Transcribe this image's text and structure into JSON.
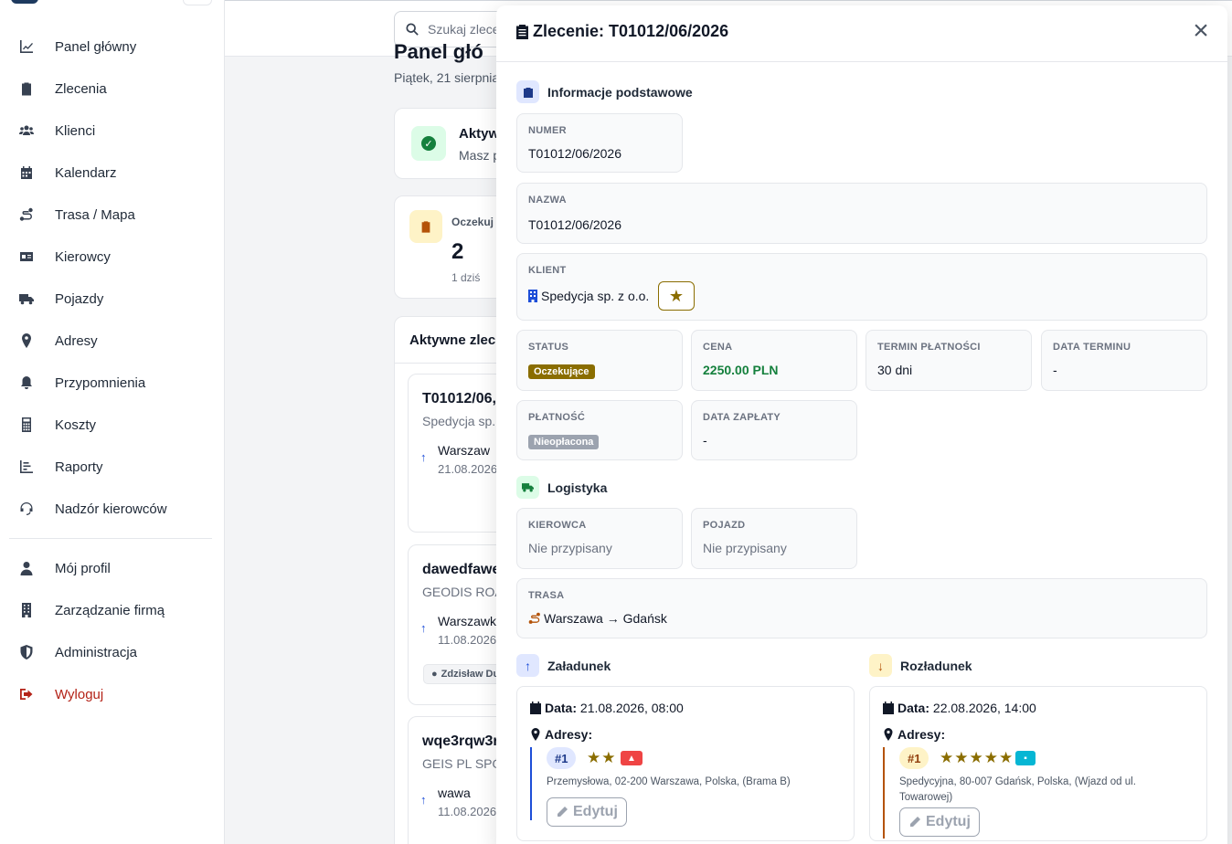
{
  "sidebar": {
    "items": [
      {
        "label": "Panel główny",
        "icon": "chart-line-icon"
      },
      {
        "label": "Zlecenia",
        "icon": "clipboard-icon"
      },
      {
        "label": "Klienci",
        "icon": "users-icon"
      },
      {
        "label": "Kalendarz",
        "icon": "calendar-icon"
      },
      {
        "label": "Trasa / Mapa",
        "icon": "route-icon"
      },
      {
        "label": "Kierowcy",
        "icon": "id-card-icon"
      },
      {
        "label": "Pojazdy",
        "icon": "truck-icon"
      },
      {
        "label": "Adresy",
        "icon": "map-pin-icon"
      },
      {
        "label": "Przypomnienia",
        "icon": "bell-icon"
      },
      {
        "label": "Koszty",
        "icon": "calculator-icon"
      },
      {
        "label": "Raporty",
        "icon": "chart-bar-icon"
      },
      {
        "label": "Nadzór kierowców",
        "icon": "headset-icon"
      }
    ],
    "bottom_items": [
      {
        "label": "Mój profil",
        "icon": "user-icon"
      },
      {
        "label": "Zarządzanie firmą",
        "icon": "building-icon"
      },
      {
        "label": "Administracja",
        "icon": "shield-icon"
      },
      {
        "label": "Wyloguj",
        "icon": "logout-icon"
      }
    ]
  },
  "topbar": {
    "search_placeholder": "Szukaj zlece"
  },
  "page": {
    "title": "Panel głó",
    "date": "Piątek, 21 sierpnia"
  },
  "status_card": {
    "title": "Aktyw",
    "text": "Masz p"
  },
  "pending_card": {
    "label": "Oczekuj",
    "count": "2",
    "today": "1 dziś"
  },
  "active_orders": {
    "title": "Aktywne zlec",
    "orders": [
      {
        "title": "T01012/06,",
        "client": "Spedycja sp. z",
        "city": "Warszaw",
        "date": "21.08.2026",
        "driver": ""
      },
      {
        "title": "dawedfawe",
        "client": "GEODIS ROAD",
        "city": "Warszawk",
        "date": "11.08.2026",
        "driver": "Zdzisław Du"
      },
      {
        "title": "wqe3rqw3r",
        "client": "GEIS PL SPÓŁ",
        "city": "wawa",
        "date": "11.08.2026",
        "driver": ""
      }
    ]
  },
  "modal": {
    "title": "Zlecenie: T01012/06/2026",
    "close": "×",
    "basic_section": "Informacje podstawowe",
    "numer_label": "NUMER",
    "numer": "T01012/06/2026",
    "nazwa_label": "NAZWA",
    "nazwa": "T01012/06/2026",
    "klient_label": "KLIENT",
    "klient": "Spedycja sp. z o.o.",
    "status_label": "STATUS",
    "status": "Oczekujące",
    "cena_label": "CENA",
    "cena": "2250.00 PLN",
    "termin_label": "TERMIN PŁATNOŚCI",
    "termin": "30 dni",
    "data_terminu_label": "DATA TERMINU",
    "data_terminu": "-",
    "platnosc_label": "PŁATNOŚĆ",
    "platnosc": "Nieopłacona",
    "data_zaplaty_label": "DATA ZAPŁATY",
    "data_zaplaty": "-",
    "logistics_section": "Logistyka",
    "kierowca_label": "KIEROWCA",
    "kierowca": "Nie przypisany",
    "pojazd_label": "POJAZD",
    "pojazd": "Nie przypisany",
    "trasa_label": "TRASA",
    "trasa": "Warszawa → Gdańsk",
    "loading": {
      "section": "Załadunek",
      "date_label": "Data:",
      "date": "21.08.2026, 08:00",
      "addr_label": "Adresy:",
      "num": "#1",
      "rating": 2,
      "address": "Przemysłowa, 02-200 Warszawa, Polska, (Brama B)",
      "edit": "Edytuj"
    },
    "unloading": {
      "section": "Rozładunek",
      "date_label": "Data:",
      "date": "22.08.2026, 14:00",
      "addr_label": "Adresy:",
      "num": "#1",
      "rating": 5,
      "address_line1": "Spedycyjna, 80-007 Gdańsk, Polska, (Wjazd od ul.",
      "address_line2": "Towarowej)",
      "edit": "Edytuj"
    }
  },
  "colors": {
    "status_badge": "#8a6d00",
    "price": "#15803d",
    "unpaid_badge": "#9ca3af",
    "logout": "#b42318",
    "loading_accent": "#1d4ed8",
    "unloading_accent": "#b45309"
  }
}
